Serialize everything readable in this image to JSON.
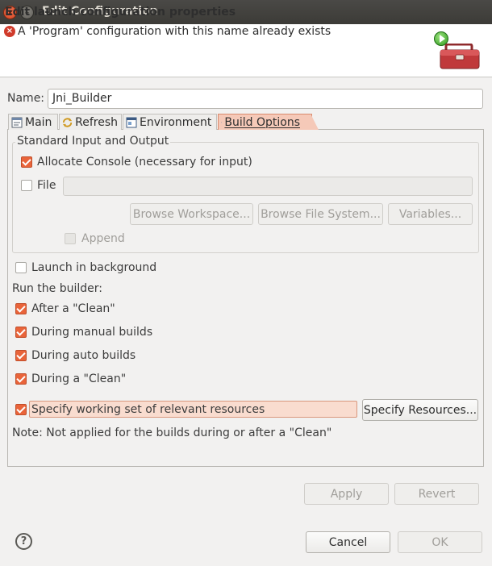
{
  "window": {
    "title": "Edit Configuration",
    "close_glyph": "×",
    "minimize_glyph": "–"
  },
  "header": {
    "title": "Edit launch configuration properties",
    "error_message": "A 'Program' configuration with this name already exists",
    "error_glyph": "×"
  },
  "name_field": {
    "label": "Name:",
    "value": "Jni_Builder"
  },
  "tabs": [
    {
      "label": "Main",
      "icon": "main-tab-icon",
      "active": false
    },
    {
      "label": "Refresh",
      "icon": "refresh-icon",
      "active": false
    },
    {
      "label": "Environment",
      "icon": "environment-icon",
      "active": false
    },
    {
      "label": "Build Options",
      "icon": "build-options-icon",
      "active": true
    }
  ],
  "std_io": {
    "group_title": "Standard Input and Output",
    "allocate_console": {
      "label": "Allocate Console (necessary for input)",
      "checked": true
    },
    "file": {
      "label": "File",
      "checked": false,
      "value": ""
    },
    "browse_workspace": "Browse Workspace...",
    "browse_file_system": "Browse File System...",
    "variables": "Variables...",
    "append": {
      "label": "Append",
      "checked": false
    }
  },
  "options": {
    "launch_background": {
      "label": "Launch in background",
      "checked": false
    },
    "run_builder_label": "Run the builder:",
    "after_clean": {
      "label": "After a \"Clean\"",
      "checked": true
    },
    "manual_builds": {
      "label": "During manual builds",
      "checked": true
    },
    "auto_builds": {
      "label": "During auto builds",
      "checked": true
    },
    "during_clean": {
      "label": "During a \"Clean\"",
      "checked": true
    },
    "working_set": {
      "label": "Specify working set of relevant resources",
      "checked": true
    },
    "specify_resources": "Specify Resources...",
    "note": "Note: Not applied for the builds during or after a \"Clean\""
  },
  "buttons": {
    "apply": "Apply",
    "revert": "Revert",
    "cancel": "Cancel",
    "ok": "OK",
    "help_glyph": "?"
  },
  "colors": {
    "accent": "#e9643a",
    "active_tab": "#f5c9b8",
    "error": "#d03b2b",
    "run_green": "#2f9a1e",
    "toolbox_red": "#c0393b"
  }
}
